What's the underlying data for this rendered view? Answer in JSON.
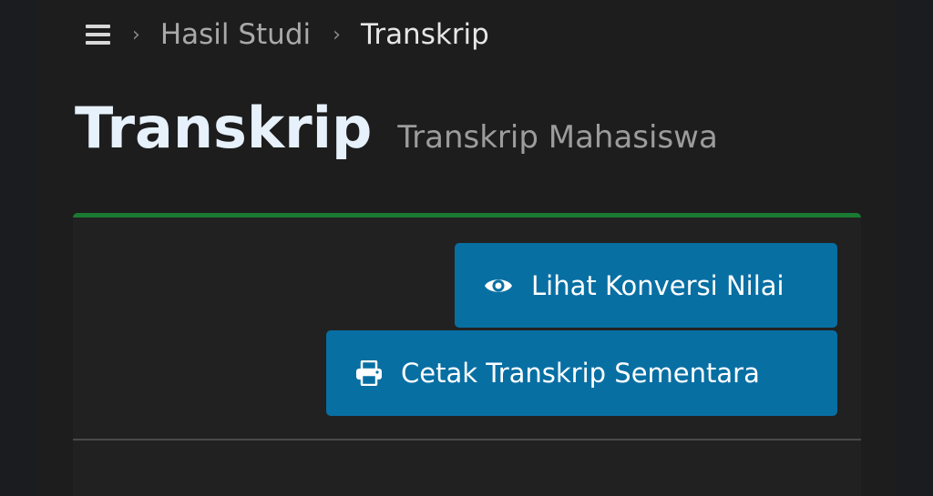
{
  "breadcrumb": {
    "menu_icon": "hamburger-icon",
    "separator": "›",
    "items": [
      {
        "label": "Hasil Studi"
      },
      {
        "label": "Transkrip"
      }
    ]
  },
  "header": {
    "title": "Transkrip",
    "subtitle": "Transkrip Mahasiswa"
  },
  "colors": {
    "accent_border": "#1b7a32",
    "button_bg": "#086fa3",
    "title_color": "#e6f1fb"
  },
  "actions": {
    "view_conversion": {
      "label": "Lihat Konversi Nilai",
      "icon": "eye-icon"
    },
    "print_transcript": {
      "label": "Cetak Transkrip Sementara",
      "icon": "printer-icon"
    }
  }
}
